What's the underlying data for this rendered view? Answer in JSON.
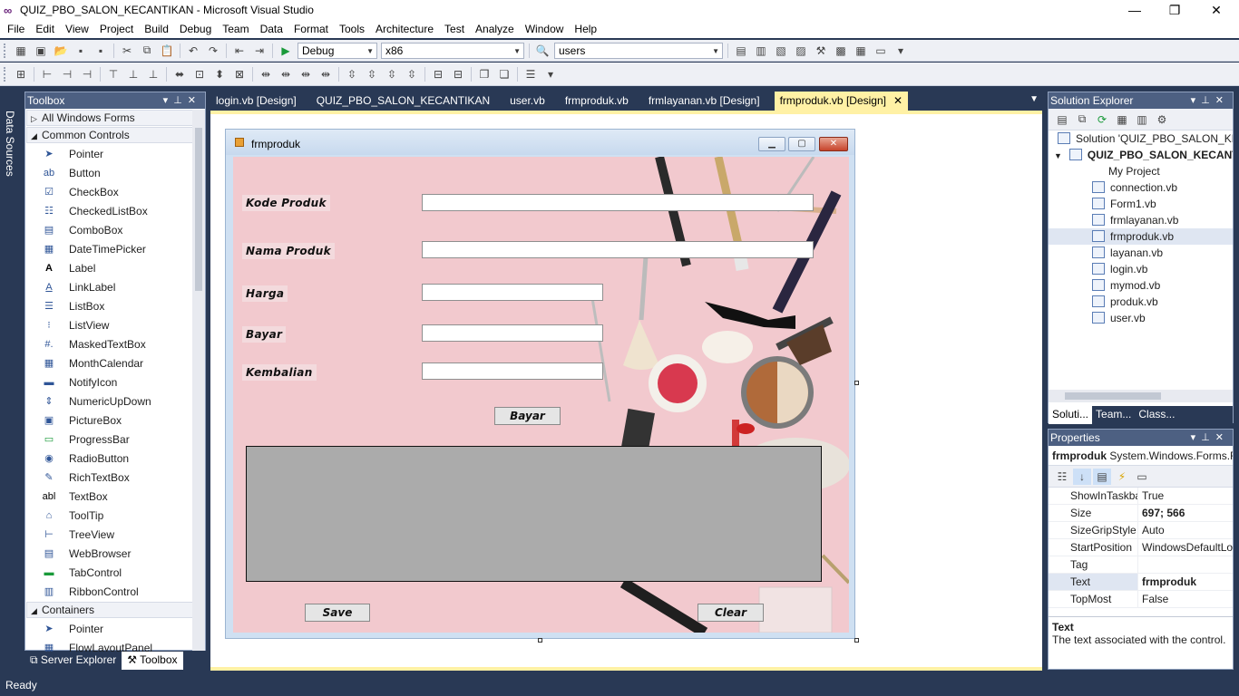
{
  "window": {
    "title": "QUIZ_PBO_SALON_KECANTIKAN - Microsoft Visual Studio",
    "minimize": "—",
    "restore": "❐",
    "close": "✕"
  },
  "menu": [
    "File",
    "Edit",
    "View",
    "Project",
    "Build",
    "Debug",
    "Team",
    "Data",
    "Format",
    "Tools",
    "Architecture",
    "Test",
    "Analyze",
    "Window",
    "Help"
  ],
  "toolbar": {
    "config": "Debug",
    "platform": "x86",
    "find": "users"
  },
  "side_tab": "Data Sources",
  "toolbox": {
    "title": "Toolbox",
    "groups": {
      "all": "All Windows Forms",
      "common": "Common Controls",
      "containers": "Containers"
    },
    "items": [
      "Pointer",
      "Button",
      "CheckBox",
      "CheckedListBox",
      "ComboBox",
      "DateTimePicker",
      "Label",
      "LinkLabel",
      "ListBox",
      "ListView",
      "MaskedTextBox",
      "MonthCalendar",
      "NotifyIcon",
      "NumericUpDown",
      "PictureBox",
      "ProgressBar",
      "RadioButton",
      "RichTextBox",
      "TextBox",
      "ToolTip",
      "TreeView",
      "WebBrowser",
      "TabControl",
      "RibbonControl"
    ],
    "container_items": [
      "Pointer",
      "FlowLayoutPanel"
    ]
  },
  "bottom_tabs": [
    "Server Explorer",
    "Toolbox"
  ],
  "doc_tabs": [
    "login.vb [Design]",
    "QUIZ_PBO_SALON_KECANTIKAN",
    "user.vb",
    "frmproduk.vb",
    "frmlayanan.vb [Design]",
    "frmproduk.vb [Design]"
  ],
  "form": {
    "title": "frmproduk",
    "labels": {
      "kode": "Kode Produk",
      "nama": "Nama Produk",
      "harga": "Harga",
      "bayar": "Bayar",
      "kembalian": "Kembalian"
    },
    "buttons": {
      "bayar": "Bayar",
      "save": "Save",
      "clear": "Clear"
    }
  },
  "solution_explorer": {
    "title": "Solution Explorer",
    "solution": "Solution 'QUIZ_PBO_SALON_KECANTIKAN'",
    "project": "QUIZ_PBO_SALON_KECANTIKAN",
    "files": [
      "My Project",
      "connection.vb",
      "Form1.vb",
      "frmlayanan.vb",
      "frmproduk.vb",
      "layanan.vb",
      "login.vb",
      "mymod.vb",
      "produk.vb",
      "user.vb"
    ],
    "tabs": [
      "Soluti...",
      "Team...",
      "Class..."
    ]
  },
  "properties": {
    "title": "Properties",
    "object_name": "frmproduk",
    "object_type": "System.Windows.Forms.Form",
    "rows": [
      {
        "name": "ShowInTaskbar",
        "value": "True"
      },
      {
        "name": "Size",
        "value": "697; 566"
      },
      {
        "name": "SizeGripStyle",
        "value": "Auto"
      },
      {
        "name": "StartPosition",
        "value": "WindowsDefaultLocation"
      },
      {
        "name": "Tag",
        "value": ""
      },
      {
        "name": "Text",
        "value": "frmproduk"
      },
      {
        "name": "TopMost",
        "value": "False"
      }
    ],
    "desc_title": "Text",
    "desc_body": "The text associated with the control."
  },
  "status": "Ready"
}
